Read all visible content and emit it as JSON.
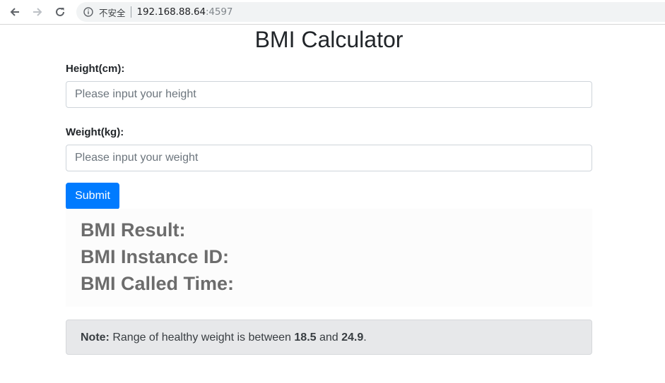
{
  "browser": {
    "security_label": "不安全",
    "url_host": "192.168.88.64",
    "url_port": ":4597"
  },
  "page": {
    "title": "BMI Calculator",
    "height_label": "Height(cm):",
    "height_placeholder": "Please input your height",
    "height_value": "",
    "weight_label": "Weight(kg):",
    "weight_placeholder": "Please input your weight",
    "weight_value": "",
    "submit_label": "Submit",
    "result": {
      "bmi_result_label": "BMI Result:",
      "instance_id_label": "BMI Instance ID:",
      "called_time_label": "BMI Called Time:"
    },
    "note": {
      "prefix": "Note:",
      "text_1": " Range of healthy weight is between ",
      "low": "18.5",
      "text_2": " and ",
      "high": "24.9",
      "text_3": "."
    }
  },
  "icons": {
    "back": "arrow-left-icon",
    "forward": "arrow-right-icon",
    "reload": "reload-icon",
    "info": "info-circle-icon"
  },
  "colors": {
    "primary_button": "#007bff",
    "note_background": "#e7e8ea",
    "result_text": "#6c6c6c"
  }
}
